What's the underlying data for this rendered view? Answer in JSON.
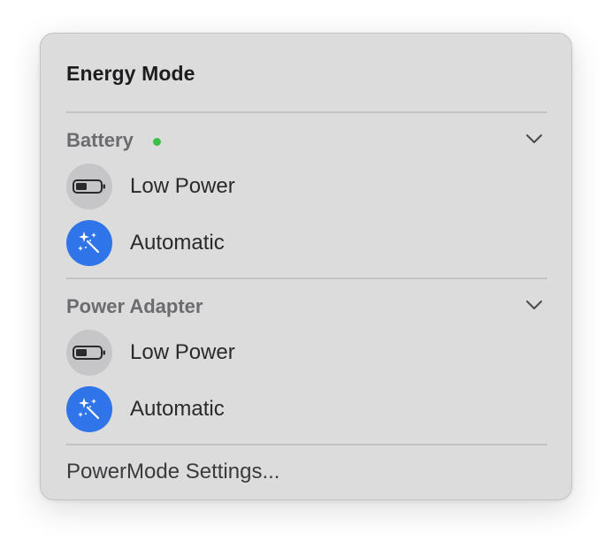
{
  "menu": {
    "title": "Energy Mode",
    "sections": [
      {
        "label": "Battery",
        "active_indicator_color": "#3bbf4a",
        "expand_icon": "chevron-down-icon",
        "options": [
          {
            "label": "Low Power",
            "icon": "battery-low-icon",
            "selected": false
          },
          {
            "label": "Automatic",
            "icon": "magic-wand-icon",
            "selected": true,
            "accent": "#2f74e8"
          }
        ]
      },
      {
        "label": "Power Adapter",
        "expand_icon": "chevron-down-icon",
        "options": [
          {
            "label": "Low Power",
            "icon": "battery-low-icon",
            "selected": false
          },
          {
            "label": "Automatic",
            "icon": "magic-wand-icon",
            "selected": true,
            "accent": "#2f74e8"
          }
        ]
      }
    ],
    "settings_label": "PowerMode Settings..."
  }
}
